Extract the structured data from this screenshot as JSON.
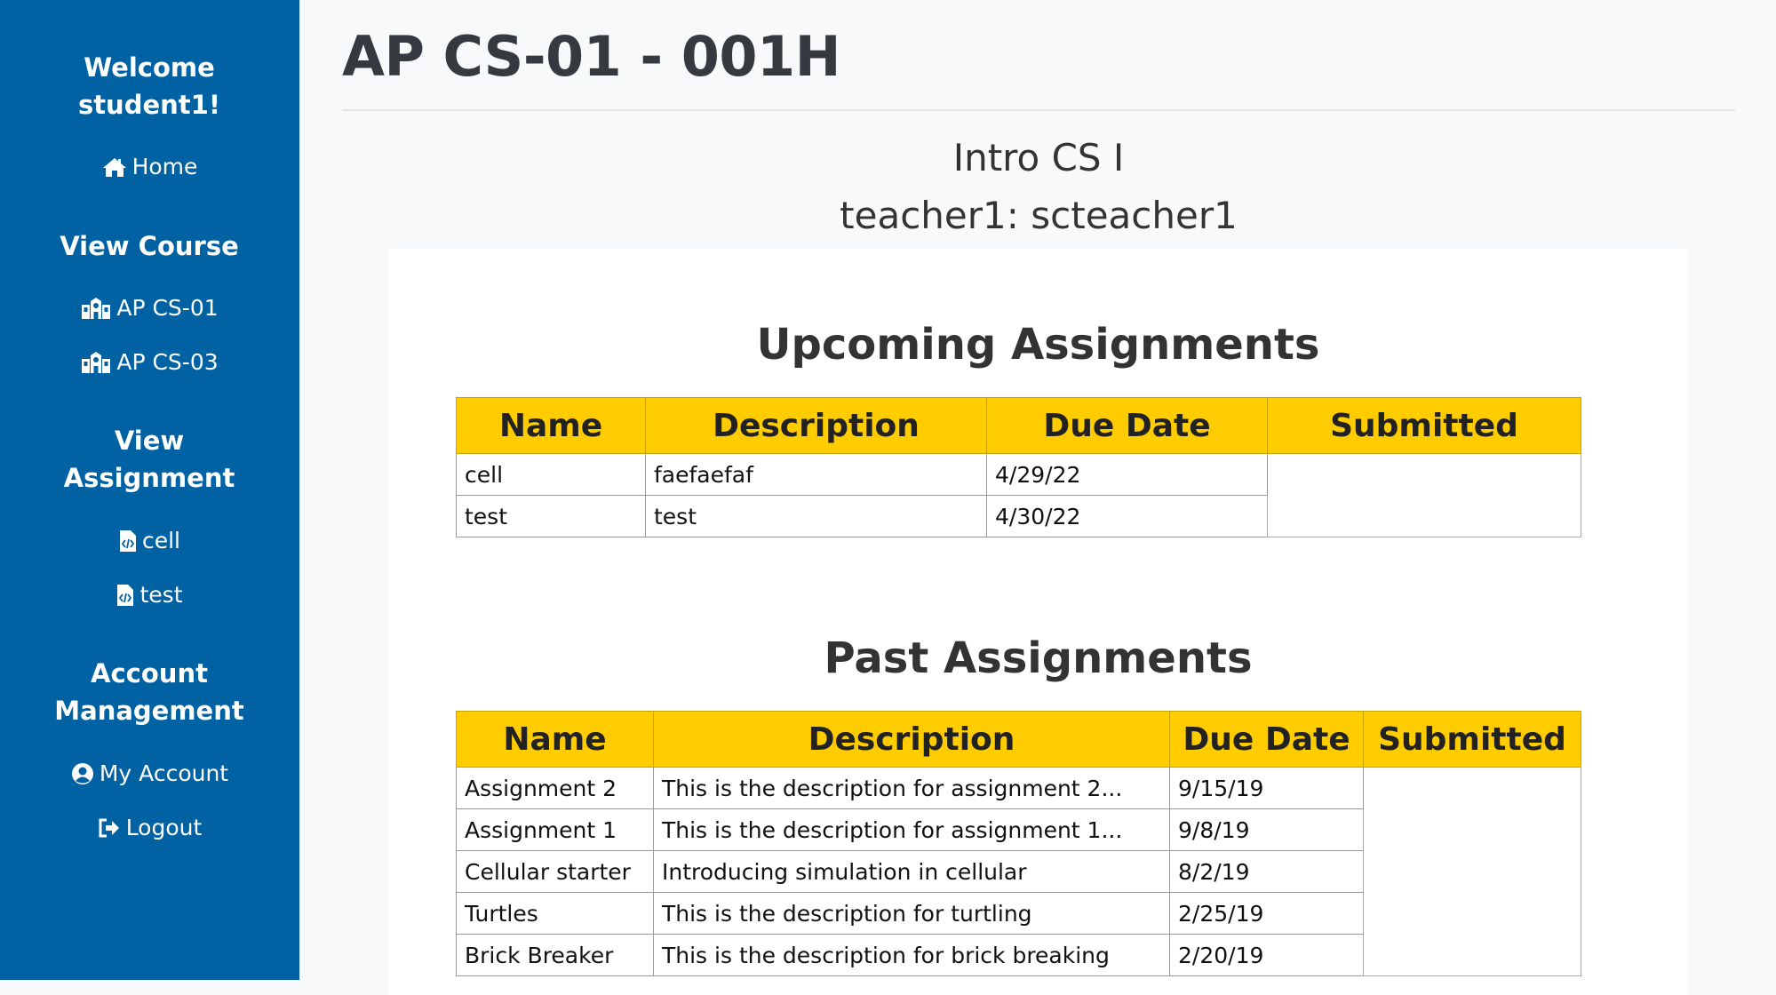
{
  "sidebar": {
    "welcome_line1": "Welcome",
    "welcome_line2": "student1!",
    "home_label": "Home",
    "view_course_heading": "View Course",
    "courses": [
      {
        "label": "AP CS-01"
      },
      {
        "label": "AP CS-03"
      }
    ],
    "view_assignment_line1": "View",
    "view_assignment_line2": "Assignment",
    "assignments": [
      {
        "label": "cell"
      },
      {
        "label": "test"
      }
    ],
    "account_line1": "Account",
    "account_line2": "Management",
    "my_account_label": "My Account",
    "logout_label": "Logout"
  },
  "main": {
    "title": "AP CS-01 - 001H",
    "course_name": "Intro CS I",
    "teacher": "teacher1: scteacher1",
    "upcoming": {
      "title": "Upcoming Assignments",
      "headers": [
        "Name",
        "Description",
        "Due Date",
        "Submitted"
      ],
      "rows": [
        {
          "name": "cell",
          "description": "faefaefaf",
          "due": "4/29/22"
        },
        {
          "name": "test",
          "description": "test",
          "due": "4/30/22"
        }
      ]
    },
    "past": {
      "title": "Past Assignments",
      "headers": [
        "Name",
        "Description",
        "Due Date",
        "Submitted"
      ],
      "rows": [
        {
          "name": "Assignment 2",
          "description": "This is the description for assignment 2...",
          "due": "9/15/19"
        },
        {
          "name": "Assignment 1",
          "description": "This is the description for assignment 1...",
          "due": "9/8/19"
        },
        {
          "name": "Cellular starter",
          "description": "Introducing simulation in cellular",
          "due": "8/2/19"
        },
        {
          "name": "Turtles",
          "description": "This is the description for turtling",
          "due": "2/25/19"
        },
        {
          "name": "Brick Breaker",
          "description": "This is the description for brick breaking",
          "due": "2/20/19"
        }
      ]
    }
  },
  "colors": {
    "sidebar_bg": "#0062a3",
    "table_header_bg": "#ffcc00",
    "page_bg": "#f8f9fa"
  }
}
